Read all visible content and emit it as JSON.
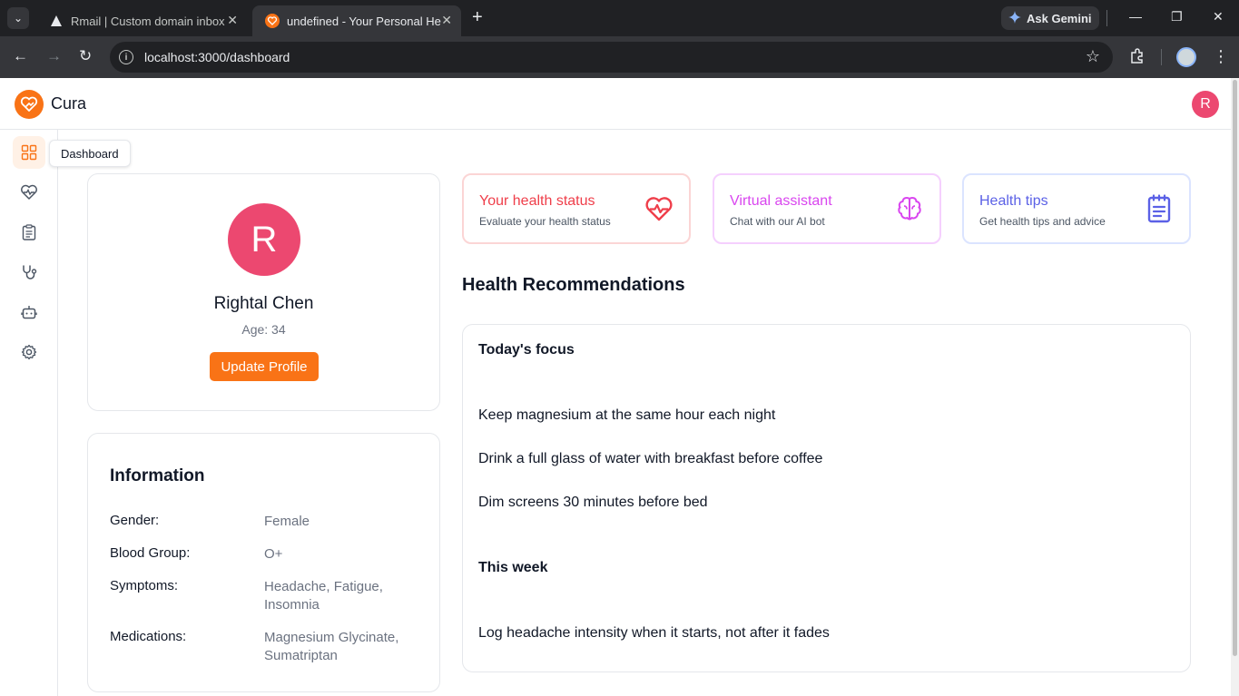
{
  "browser": {
    "tabs": [
      {
        "title": "Rmail | Custom domain inbox for"
      },
      {
        "title": "undefined - Your Personal Health"
      }
    ],
    "ask_gemini": "Ask Gemini",
    "url": "localhost:3000/dashboard"
  },
  "app": {
    "brand": "Cura",
    "user_initial": "R",
    "tooltip": "Dashboard",
    "accent_color": "#f97316"
  },
  "sidebar": {
    "items": [
      {
        "icon": "dashboard-grid-icon",
        "active": true
      },
      {
        "icon": "heart-pulse-icon"
      },
      {
        "icon": "clipboard-icon"
      },
      {
        "icon": "stethoscope-icon"
      },
      {
        "icon": "bot-icon"
      },
      {
        "icon": "settings-gear-icon"
      }
    ]
  },
  "profile": {
    "initial": "R",
    "name": "Rightal Chen",
    "age": "Age: 34",
    "update_button": "Update Profile"
  },
  "information": {
    "title": "Information",
    "rows": [
      {
        "label": "Gender:",
        "value": "Female"
      },
      {
        "label": "Blood Group:",
        "value": "O+"
      },
      {
        "label": "Symptoms:",
        "value": "Headache, Fatigue, Insomnia"
      },
      {
        "label": "Medications:",
        "value": "Magnesium Glycinate, Sumatriptan"
      }
    ]
  },
  "features": [
    {
      "title": "Your health status",
      "subtitle": "Evaluate your health status",
      "icon": "heart-pulse-icon",
      "color": "#ef3e4a"
    },
    {
      "title": "Virtual assistant",
      "subtitle": "Chat with our AI bot",
      "icon": "brain-icon",
      "color": "#d946ef"
    },
    {
      "title": "Health tips",
      "subtitle": "Get health tips and advice",
      "icon": "notepad-icon",
      "color": "#5b61e6"
    }
  ],
  "recommendations": {
    "heading": "Health Recommendations",
    "sections": [
      {
        "title": "Today's focus",
        "items": [
          "Keep magnesium at the same hour each night",
          "Drink a full glass of water with breakfast before coffee",
          "Dim screens 30 minutes before bed"
        ]
      },
      {
        "title": "This week",
        "items": [
          "Log headache intensity when it starts, not after it fades"
        ]
      }
    ]
  }
}
